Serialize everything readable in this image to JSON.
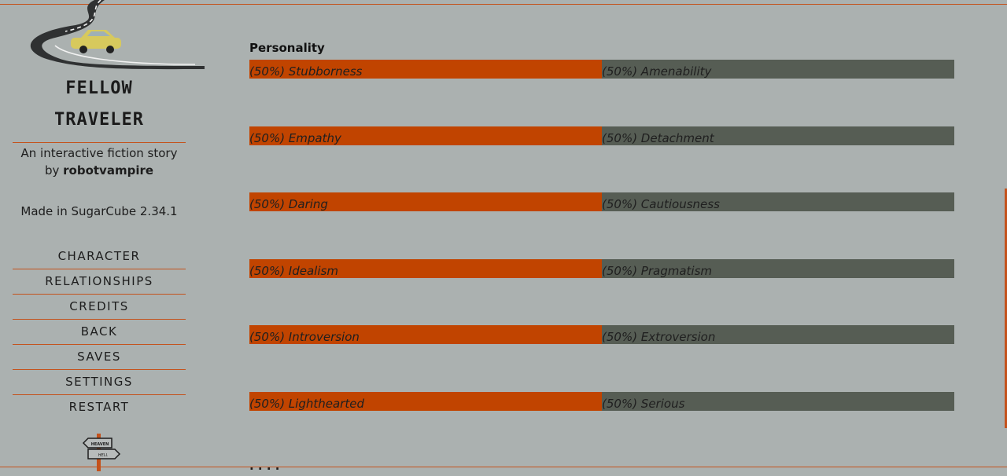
{
  "story": {
    "title_line1": "FELLOW",
    "title_line2": "TRAVELER",
    "subtitle_prefix": "An interactive fiction story",
    "by_label": "by",
    "author": "robotvampire",
    "made_in": "Made in SugarCube 2.34.1"
  },
  "menu": [
    {
      "label": "CHARACTER"
    },
    {
      "label": "RELATIONSHIPS"
    },
    {
      "label": "CREDITS"
    },
    {
      "label": "BACK"
    },
    {
      "label": "SAVES"
    },
    {
      "label": "SETTINGS"
    },
    {
      "label": "RESTART"
    }
  ],
  "signpost": {
    "top": "HEAVEN",
    "bottom": "HELL"
  },
  "main": {
    "section_title": "Personality",
    "traits": [
      {
        "left": "(50%) Stubborness",
        "right": "(50%) Amenability",
        "left_fraction": 0.5
      },
      {
        "left": "(50%) Empathy",
        "right": "(50%) Detachment",
        "left_fraction": 0.5
      },
      {
        "left": "(50%) Daring",
        "right": "(50%) Cautiousness",
        "left_fraction": 0.5
      },
      {
        "left": "(50%) Idealism",
        "right": "(50%) Pragmatism",
        "left_fraction": 0.5
      },
      {
        "left": "(50%) Introversion",
        "right": "(50%) Extroversion",
        "left_fraction": 0.5
      },
      {
        "left": "(50%) Lighthearted",
        "right": "(50%) Serious",
        "left_fraction": 0.5
      }
    ]
  },
  "colors": {
    "background": "#abb1b0",
    "accent": "#c4521c",
    "bar_left": "#c14400",
    "bar_right": "#565d54"
  }
}
